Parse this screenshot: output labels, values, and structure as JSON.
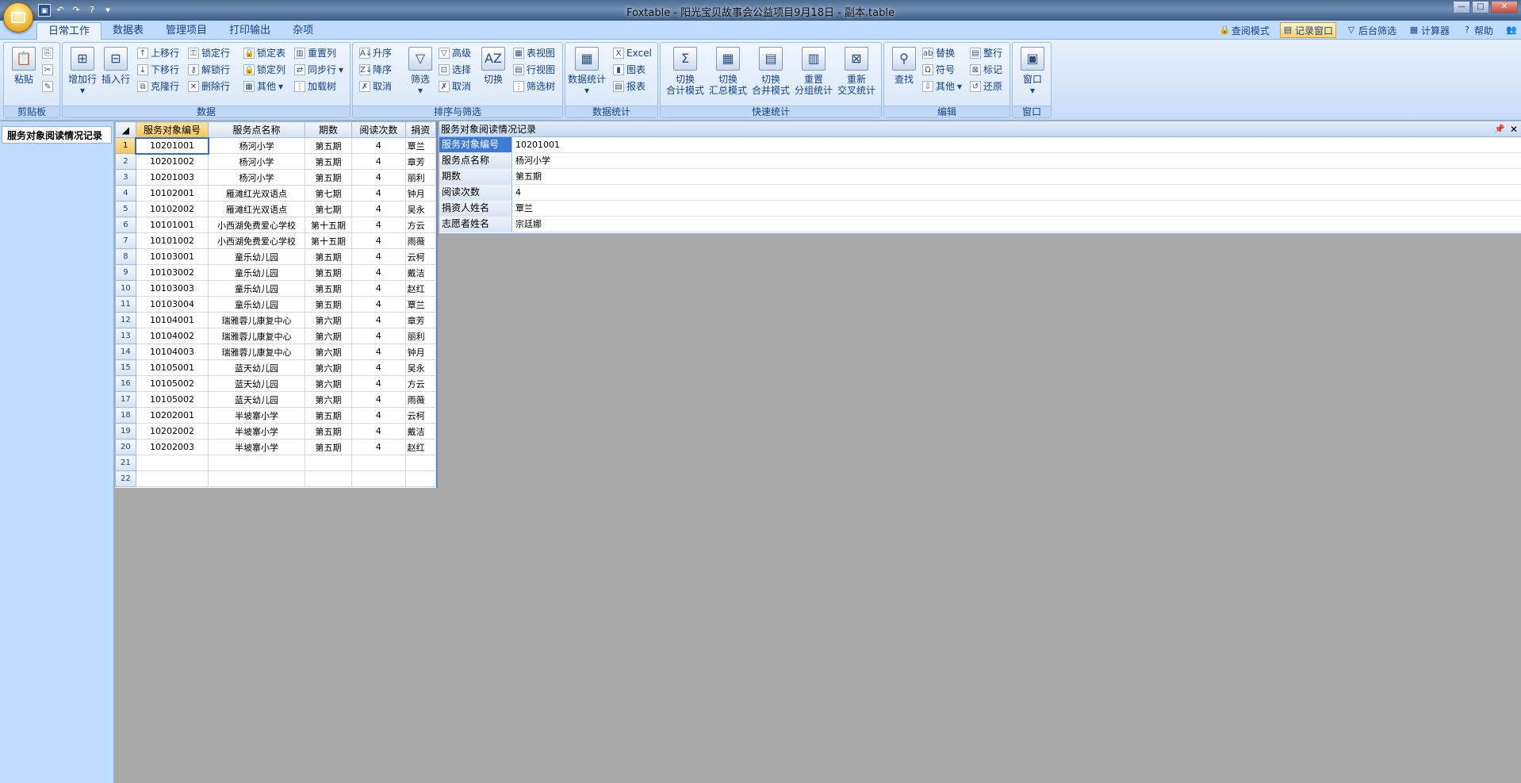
{
  "title_bar": {
    "title": "Foxtable - 阳光宝贝故事会公益项目9月18日 - 副本.table"
  },
  "tabs": [
    "日常工作",
    "数据表",
    "管理项目",
    "打印输出",
    "杂项"
  ],
  "right_tools": {
    "query_mode": "查阅模式",
    "record_window": "记录窗口",
    "background_filter": "后台筛选",
    "calculator": "计算器",
    "help": "帮助"
  },
  "ribbon": {
    "clipboard": {
      "label": "剪贴板",
      "paste": "粘贴"
    },
    "data": {
      "label": "数据",
      "add_row": "增加行",
      "insert_row": "插入行",
      "move_up": "上移行",
      "move_down": "下移行",
      "clone_row": "克隆行",
      "lock_row": "锁定行",
      "unlock_row": "解锁行",
      "delete_row": "删除行",
      "lock_table": "锁定表",
      "lock_col": "锁定列",
      "other": "其他",
      "reset_col": "重置列",
      "sync_row": "同步行",
      "load_tree": "加载树"
    },
    "sort_filter": {
      "label": "排序与筛选",
      "asc": "升序",
      "desc": "降序",
      "cancel_sort": "取消",
      "filter": "筛选",
      "advanced": "高级",
      "select": "选择",
      "cancel_filter": "取消",
      "switch": "切换",
      "table_view": "表视图",
      "row_view": "行视图",
      "filter_tree": "筛选树"
    },
    "stats": {
      "label": "数据统计",
      "data_stats": "数据统计",
      "excel": "Excel",
      "chart": "图表",
      "report": "报表"
    },
    "quick_stats": {
      "label": "快速统计",
      "b1": [
        "切换",
        "合计模式"
      ],
      "b2": [
        "切换",
        "汇总模式"
      ],
      "b3": [
        "切换",
        "合并模式"
      ],
      "b4": [
        "重置",
        "分组统计"
      ],
      "b5": [
        "重新",
        "交叉统计"
      ]
    },
    "edit": {
      "label": "编辑",
      "find": "查找",
      "replace": "替换",
      "symbol": "符号",
      "other": "其他",
      "tidy_row": "整行",
      "mark": "标记",
      "restore": "还原"
    },
    "window": {
      "label": "窗口",
      "window": "窗口"
    }
  },
  "nav": {
    "item": "服务对象阅读情况记录"
  },
  "grid": {
    "columns": [
      "服务对象编号",
      "服务点名称",
      "期数",
      "阅读次数",
      "捐资"
    ],
    "rows": [
      [
        "10201001",
        "杨河小学",
        "第五期",
        "4",
        "覃兰"
      ],
      [
        "10201002",
        "杨河小学",
        "第五期",
        "4",
        "章芳"
      ],
      [
        "10201003",
        "杨河小学",
        "第五期",
        "4",
        "丽利"
      ],
      [
        "10102001",
        "雁滩红光双语点",
        "第七期",
        "4",
        "钟月"
      ],
      [
        "10102002",
        "雁滩红光双语点",
        "第七期",
        "4",
        "吴永"
      ],
      [
        "10101001",
        "小西湖免费爱心学校",
        "第十五期",
        "4",
        "方云"
      ],
      [
        "10101002",
        "小西湖免费爱心学校",
        "第十五期",
        "4",
        "雨薇"
      ],
      [
        "10103001",
        "童乐幼儿园",
        "第五期",
        "4",
        "云柯"
      ],
      [
        "10103002",
        "童乐幼儿园",
        "第五期",
        "4",
        "戴洁"
      ],
      [
        "10103003",
        "童乐幼儿园",
        "第五期",
        "4",
        "赵红"
      ],
      [
        "10103004",
        "童乐幼儿园",
        "第五期",
        "4",
        "覃兰"
      ],
      [
        "10104001",
        "瑞雅蓉儿康复中心",
        "第六期",
        "4",
        "章芳"
      ],
      [
        "10104002",
        "瑞雅蓉儿康复中心",
        "第六期",
        "4",
        "丽利"
      ],
      [
        "10104003",
        "瑞雅蓉儿康复中心",
        "第六期",
        "4",
        "钟月"
      ],
      [
        "10105001",
        "蓝天幼儿园",
        "第六期",
        "4",
        "吴永"
      ],
      [
        "10105002",
        "蓝天幼儿园",
        "第六期",
        "4",
        "方云"
      ],
      [
        "10105002",
        "蓝天幼儿园",
        "第六期",
        "4",
        "雨薇"
      ],
      [
        "10202001",
        "半坡寨小学",
        "第五期",
        "4",
        "云柯"
      ],
      [
        "10202002",
        "半坡寨小学",
        "第五期",
        "4",
        "戴洁"
      ],
      [
        "10202003",
        "半坡寨小学",
        "第五期",
        "4",
        "赵红"
      ],
      [
        "",
        "",
        "",
        "",
        ""
      ],
      [
        "",
        "",
        "",
        "",
        ""
      ]
    ]
  },
  "record": {
    "title": "服务对象阅读情况记录",
    "fields": [
      {
        "label": "服务对象编号",
        "value": "10201001"
      },
      {
        "label": "服务点名称",
        "value": "杨河小学"
      },
      {
        "label": "期数",
        "value": "第五期"
      },
      {
        "label": "阅读次数",
        "value": "4"
      },
      {
        "label": "捐资人姓名",
        "value": "覃兰"
      },
      {
        "label": "志愿者姓名",
        "value": "宗廷娜"
      }
    ]
  }
}
